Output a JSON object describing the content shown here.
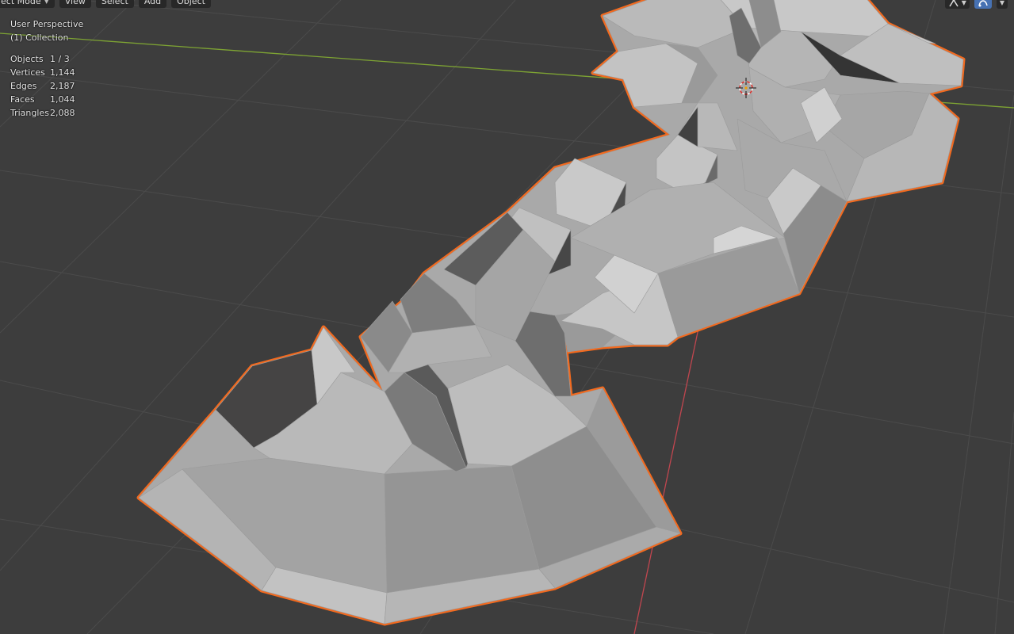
{
  "header": {
    "mode_label": "ect Mode",
    "menus": [
      "View",
      "Select",
      "Add",
      "Object"
    ]
  },
  "viewport_info": {
    "perspective": "User Perspective",
    "collection": "(1) Collection"
  },
  "stats": [
    {
      "label": "Objects",
      "value": "1 / 3"
    },
    {
      "label": "Vertices",
      "value": "1,144"
    },
    {
      "label": "Edges",
      "value": "2,187"
    },
    {
      "label": "Faces",
      "value": "1,044"
    },
    {
      "label": "Triangles",
      "value": "2,088"
    }
  ],
  "icons": {
    "mode_chevron": "chevron-down-icon",
    "overlay_toggle": "overlays-icon",
    "gizmo_toggle": "gizmo-icon",
    "cursor": "3d-cursor-icon"
  },
  "colors": {
    "background": "#3d3d3d",
    "grid": "#4a4a4a",
    "x_axis": "#c1464f",
    "y_axis": "#7ea433",
    "selection_outline": "#f26a1f",
    "mesh_light": "#b8b8b8",
    "mesh_mid": "#8a8a8a",
    "mesh_dark": "#4c4c4c"
  }
}
